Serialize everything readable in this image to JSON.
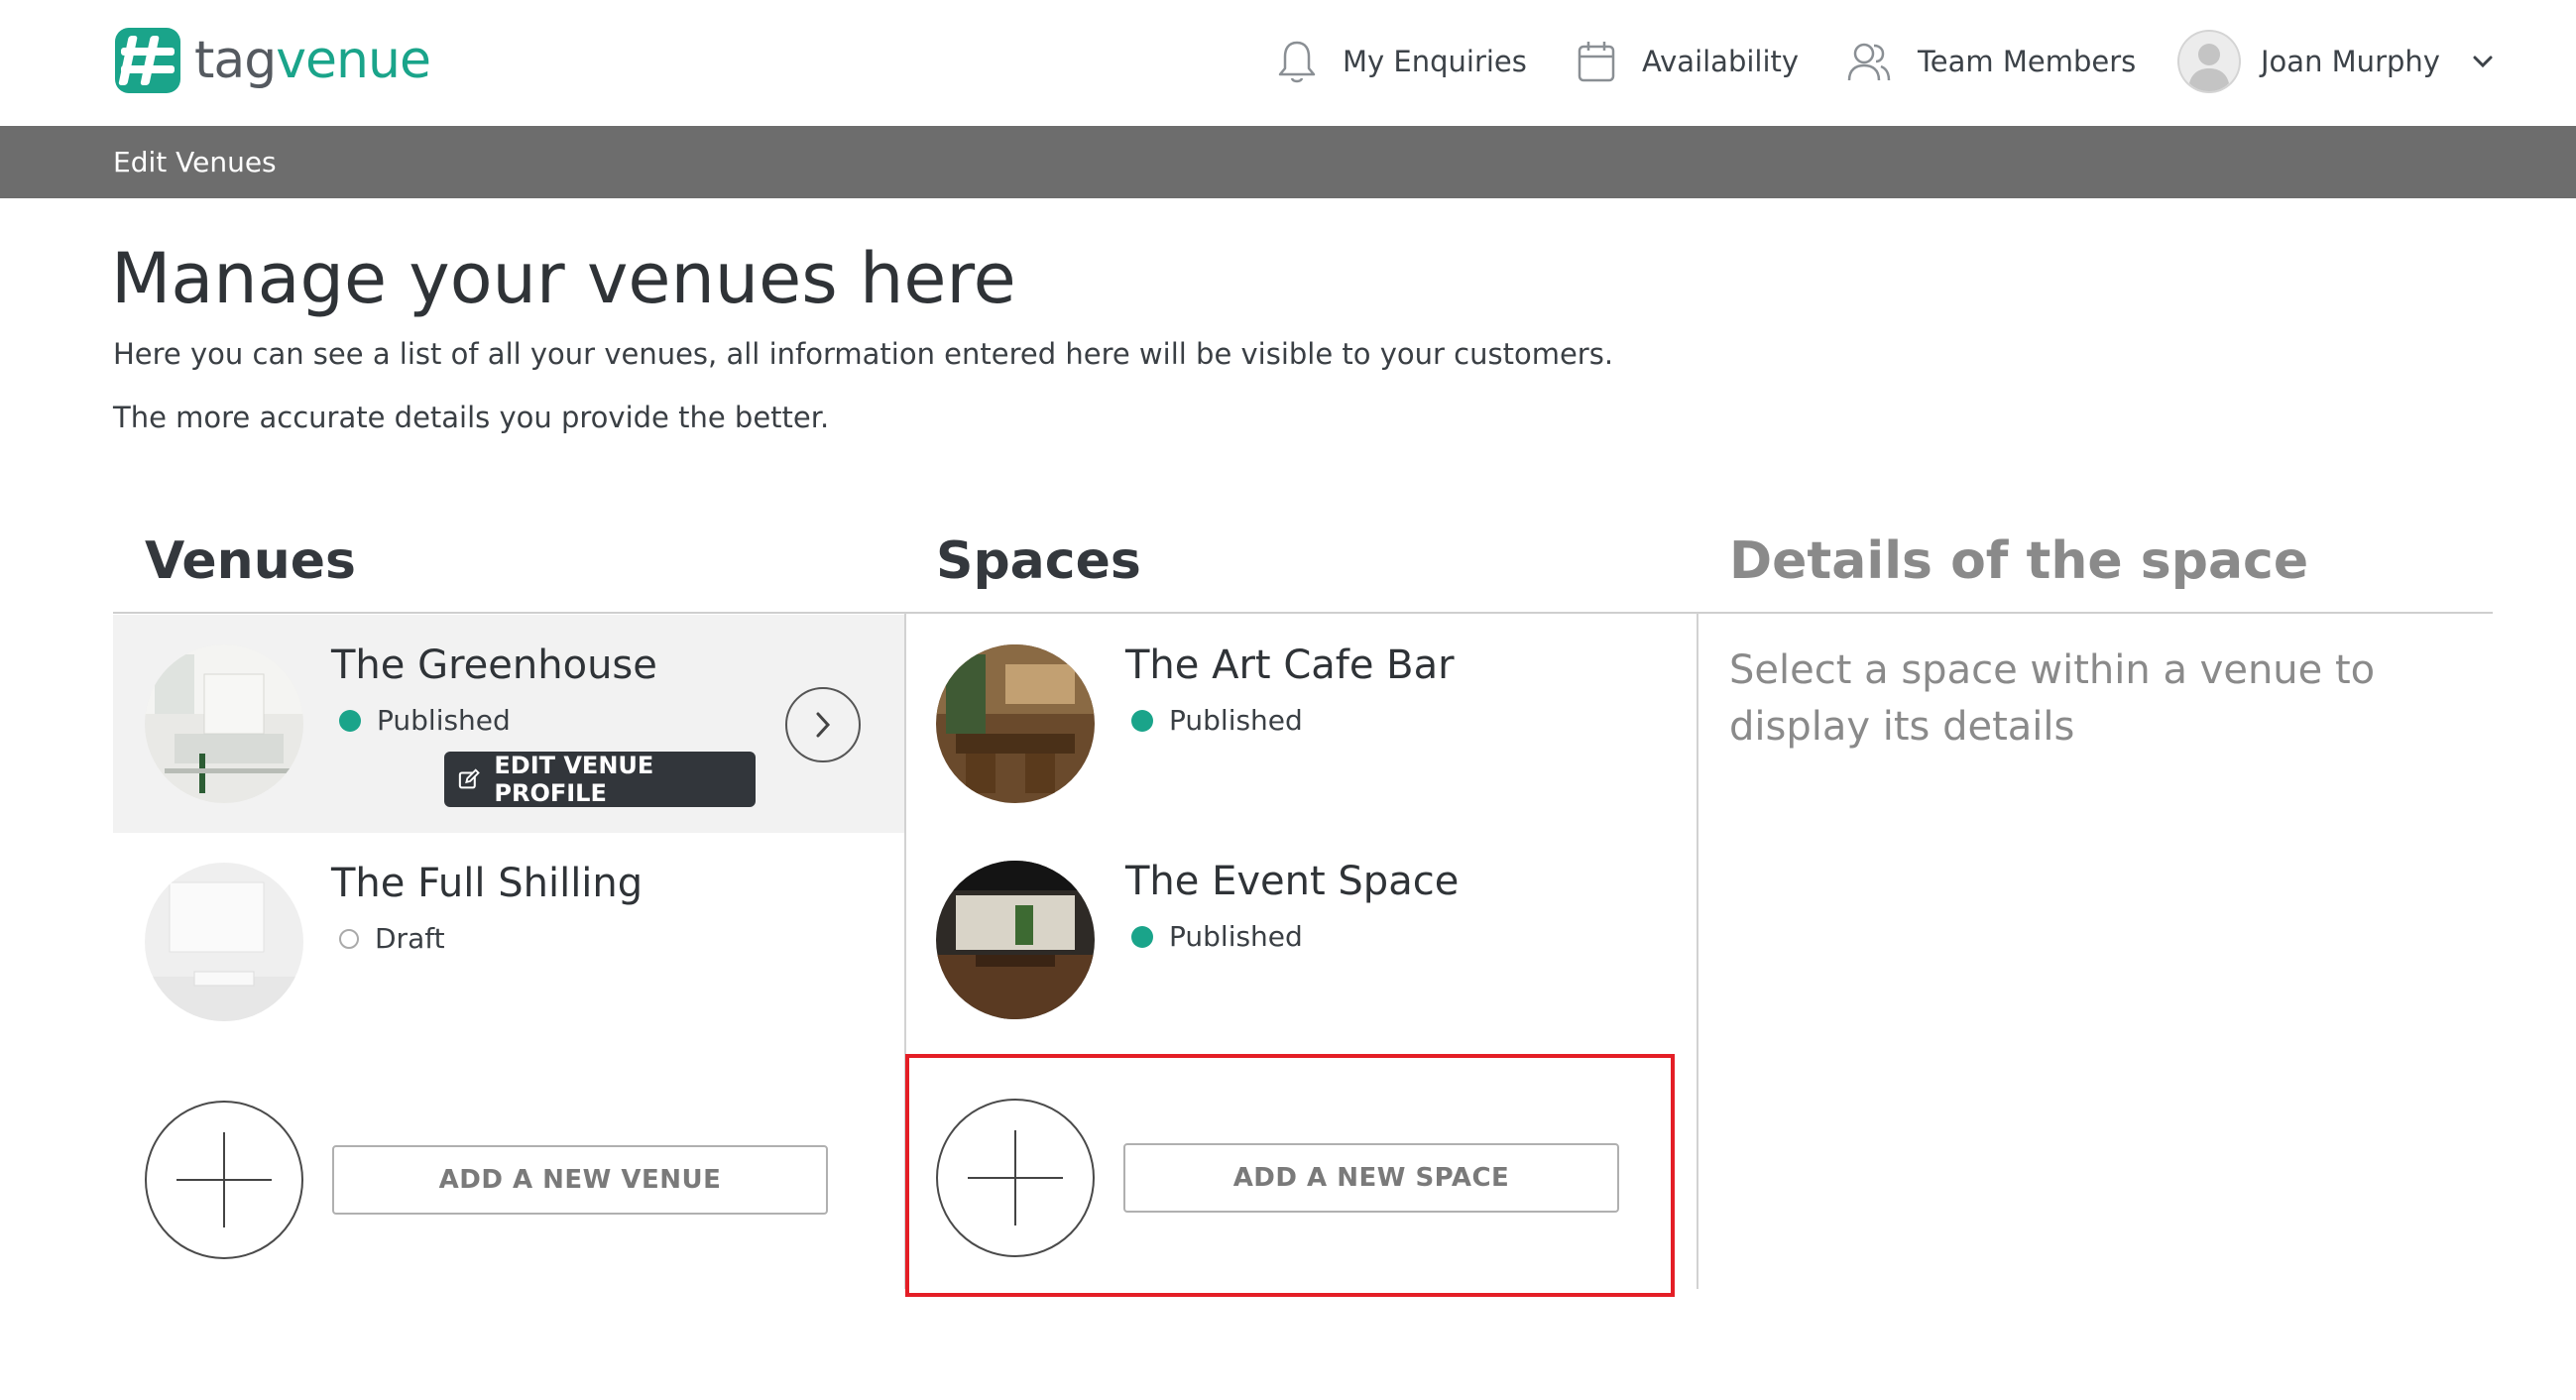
{
  "header": {
    "logo_prefix": "tag",
    "logo_suffix": "venue",
    "nav": {
      "enquiries": "My Enquiries",
      "availability": "Availability",
      "team": "Team Members",
      "user_name": "Joan Murphy"
    }
  },
  "subbar": {
    "title": "Edit Venues"
  },
  "intro": {
    "title": "Manage your venues here",
    "line1": "Here you can see a list of all your venues, all information entered here will be visible to your customers.",
    "line2": "The more accurate details you provide the better."
  },
  "columns": {
    "venues": "Venues",
    "spaces": "Spaces",
    "details": "Details of the space"
  },
  "venues": [
    {
      "name": "The Greenhouse",
      "status": "Published",
      "selected": true,
      "edit_label": "EDIT VENUE PROFILE"
    },
    {
      "name": "The Full Shilling",
      "status": "Draft",
      "selected": false
    }
  ],
  "add_venue_label": "ADD A NEW VENUE",
  "spaces": [
    {
      "name": "The Art Cafe Bar",
      "status": "Published"
    },
    {
      "name": "The Event Space",
      "status": "Published"
    }
  ],
  "add_space_label": "ADD A NEW SPACE",
  "details": {
    "empty_message": "Select a space within a venue to display its details"
  },
  "colors": {
    "brand": "#1aa48a",
    "subbar": "#6d6d6d",
    "highlight": "#e41e26",
    "edit_button": "#32363b"
  },
  "icons": [
    "logo-mark-icon",
    "bell-icon",
    "calendar-icon",
    "team-icon",
    "user-avatar-icon",
    "chevron-down-icon",
    "chevron-right-icon",
    "edit-icon",
    "plus-icon"
  ]
}
